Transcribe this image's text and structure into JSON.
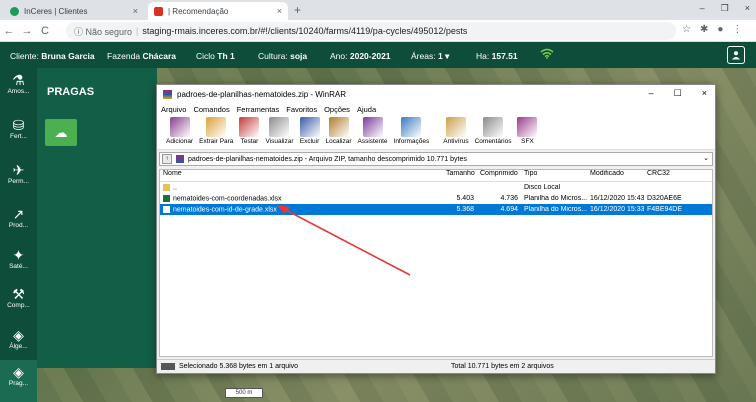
{
  "browser": {
    "tabs": [
      {
        "title": "InCeres | Clientes",
        "close": "×"
      },
      {
        "title": "| Recomendação",
        "close": "×"
      }
    ],
    "new_tab": "+",
    "win_min": "–",
    "win_max": "❐",
    "win_close": "×",
    "back": "←",
    "forward": "→",
    "reload": "C",
    "security": "ⓘ Não seguro",
    "separator": "|",
    "url": "staging-rmais.inceres.com.br/#!/clients/10240/farms/4119/pa-cycles/495012/pests",
    "star": "☆",
    "puzzle": "✱",
    "menu_dots": "⋮"
  },
  "header": {
    "cliente_label": "Cliente:",
    "cliente_value": "Bruna Garcia",
    "fazenda_label": "Fazenda",
    "fazenda_value": "Chácara",
    "ciclo_label": "Ciclo",
    "ciclo_value": "Th 1",
    "cultura_label": "Cultura:",
    "cultura_value": "soja",
    "ano_label": "Ano:",
    "ano_value": "2020-2021",
    "areas_label": "Áreas:",
    "areas_value": "1 ▾",
    "ha_label": "Ha:",
    "ha_value": "157.51",
    "wifi_icon": "wifi-icon",
    "user_icon": "user-icon"
  },
  "sidebar": {
    "items": [
      {
        "label": "Amos...",
        "glyph": "⚗"
      },
      {
        "label": "Fert...",
        "glyph": "⛁"
      },
      {
        "label": "Perm...",
        "glyph": "✈"
      },
      {
        "label": "Prod...",
        "glyph": "↗"
      },
      {
        "label": "Saté...",
        "glyph": "✦"
      },
      {
        "label": "Comp...",
        "glyph": "⚒"
      },
      {
        "label": "Álge...",
        "glyph": "◈"
      },
      {
        "label": "Prag...",
        "glyph": "◈"
      }
    ]
  },
  "panel": {
    "title": "PRAGAS",
    "upload_glyph": "☁"
  },
  "winrar": {
    "title": "padroes-de-planilhas-nematoides.zip - WinRAR",
    "ctrl_min": "–",
    "ctrl_max": "☐",
    "ctrl_close": "×",
    "menu": [
      "Arquivo",
      "Comandos",
      "Ferramentas",
      "Favoritos",
      "Opções",
      "Ajuda"
    ],
    "toolbar": [
      {
        "label": "Adicionar",
        "color": "#8a3d8f"
      },
      {
        "label": "Extrair Para",
        "color": "#d9a23a"
      },
      {
        "label": "Testar",
        "color": "#c43c3c"
      },
      {
        "label": "Visualizar",
        "color": "#8d8d8d"
      },
      {
        "label": "Excluir",
        "color": "#3b5ba8"
      },
      {
        "label": "Localizar",
        "color": "#b07c2c"
      },
      {
        "label": "Assistente",
        "color": "#7a3a9a"
      },
      {
        "label": "Informações",
        "color": "#3a7ac2"
      },
      {
        "label": "Antivírus",
        "color": "#c9a04a"
      },
      {
        "label": "Comentários",
        "color": "#8a8a8a"
      },
      {
        "label": "SFX",
        "color": "#9a3a8a"
      }
    ],
    "up_arrow": "↑",
    "path": "padroes-de-planilhas-nematoides.zip - Arquivo ZIP, tamanho descomprimido 10.771 bytes",
    "path_dropdown": "⌄",
    "columns": {
      "name": "Nome",
      "size": "Tamanho",
      "packed": "Comprimido",
      "type": "Tipo",
      "modified": "Modificado",
      "crc": "CRC32"
    },
    "rows": [
      {
        "name": "..",
        "size": "",
        "packed": "",
        "type": "Disco Local",
        "modified": "",
        "crc": "",
        "kind": "folder"
      },
      {
        "name": "nematoides-com-coordenadas.xlsx",
        "size": "5.403",
        "packed": "4.736",
        "type": "Planilha do Micros...",
        "modified": "16/12/2020 15:43",
        "crc": "D320AE6E",
        "kind": "xlsx"
      },
      {
        "name": "nematoides-com-id-de-grade.xlsx",
        "size": "5.368",
        "packed": "4.694",
        "type": "Planilha do Micros...",
        "modified": "16/12/2020 15:33",
        "crc": "F4BE94DE",
        "kind": "xlsx"
      }
    ],
    "status_left": "Selecionado 5.368 bytes em 1 arquivo",
    "status_right": "Total 10.771 bytes em 2 arquivos"
  },
  "map": {
    "scale_label": "500 m"
  }
}
